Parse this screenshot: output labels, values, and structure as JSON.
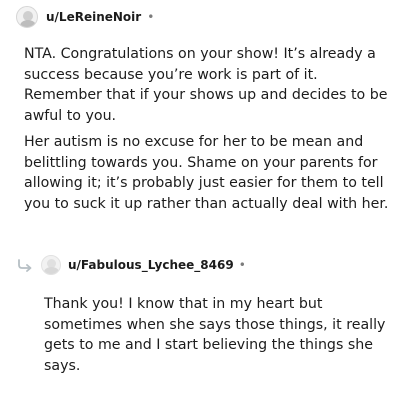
{
  "comment": {
    "username": "u/LeReineNoir",
    "separator": "•",
    "paragraphs": [
      "NTA. Congratulations on your show! It’s already a success because you’re work is part of it. Remember that if your shows up and decides to be awful to you.",
      "Her autism is no excuse for her to be mean and belittling towards you. Shame on your parents for allowing it; it’s probably just easier for them to tell you to suck it up rather than actually deal with her."
    ]
  },
  "reply": {
    "username": "u/Fabulous_Lychee_8469",
    "separator": "•",
    "paragraphs": [
      "Thank you! I know that in my heart but sometimes when she says those things, it really gets to me and I start believing the things she says."
    ]
  },
  "icons": {
    "avatar": "user-avatar-icon",
    "reply_arrow": "reply-arrow-icon"
  }
}
